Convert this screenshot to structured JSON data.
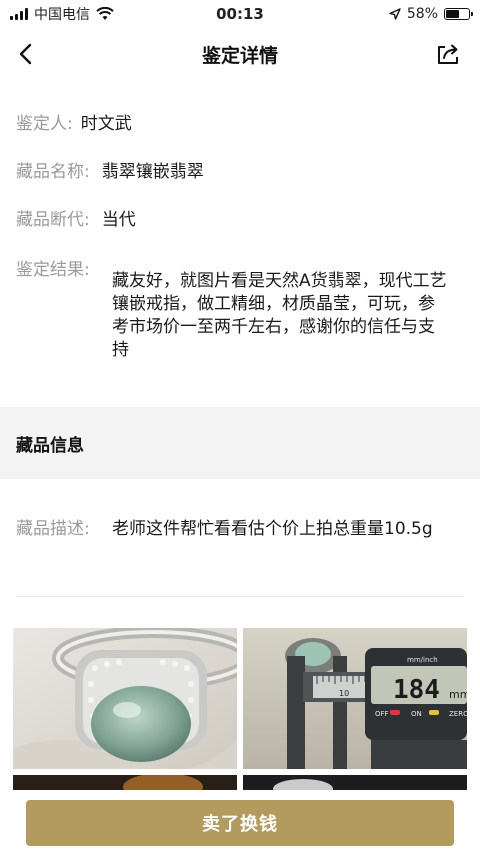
{
  "status_bar": {
    "carrier": "中国电信",
    "time": "00:13",
    "battery_percent": "58%",
    "battery_level": 0.58
  },
  "nav": {
    "title": "鉴定详情",
    "back_icon": "chevron-left-icon",
    "share_icon": "share-icon"
  },
  "appraisal": {
    "appraiser_label": "鉴定人:",
    "appraiser_value": "时文武",
    "name_label": "藏品名称:",
    "name_value": "翡翠镶嵌翡翠",
    "era_label": "藏品断代:",
    "era_value": "当代",
    "result_label": "鉴定结果:",
    "result_value": "藏友好，就图片看是天然A货翡翠，现代工艺镶嵌戒指，做工精细，材质晶莹，可玩，参考市场价一至两千左右，感谢你的信任与支持"
  },
  "collection_info": {
    "section_title": "藏品信息",
    "desc_label": "藏品描述:",
    "desc_value": "老师这件帮忙看看估个价上拍总重量10.5g"
  },
  "photos": {
    "caliper_reading": "184",
    "caliper_unit": "mm",
    "caliper_scale_label": "mm/inch",
    "caliper_off": "OFF",
    "caliper_on": "ON",
    "caliper_zero": "ZERO",
    "ruler_number": "10"
  },
  "bottom": {
    "sell_button_label": "卖了换钱",
    "accent_color": "#b39a5f"
  }
}
